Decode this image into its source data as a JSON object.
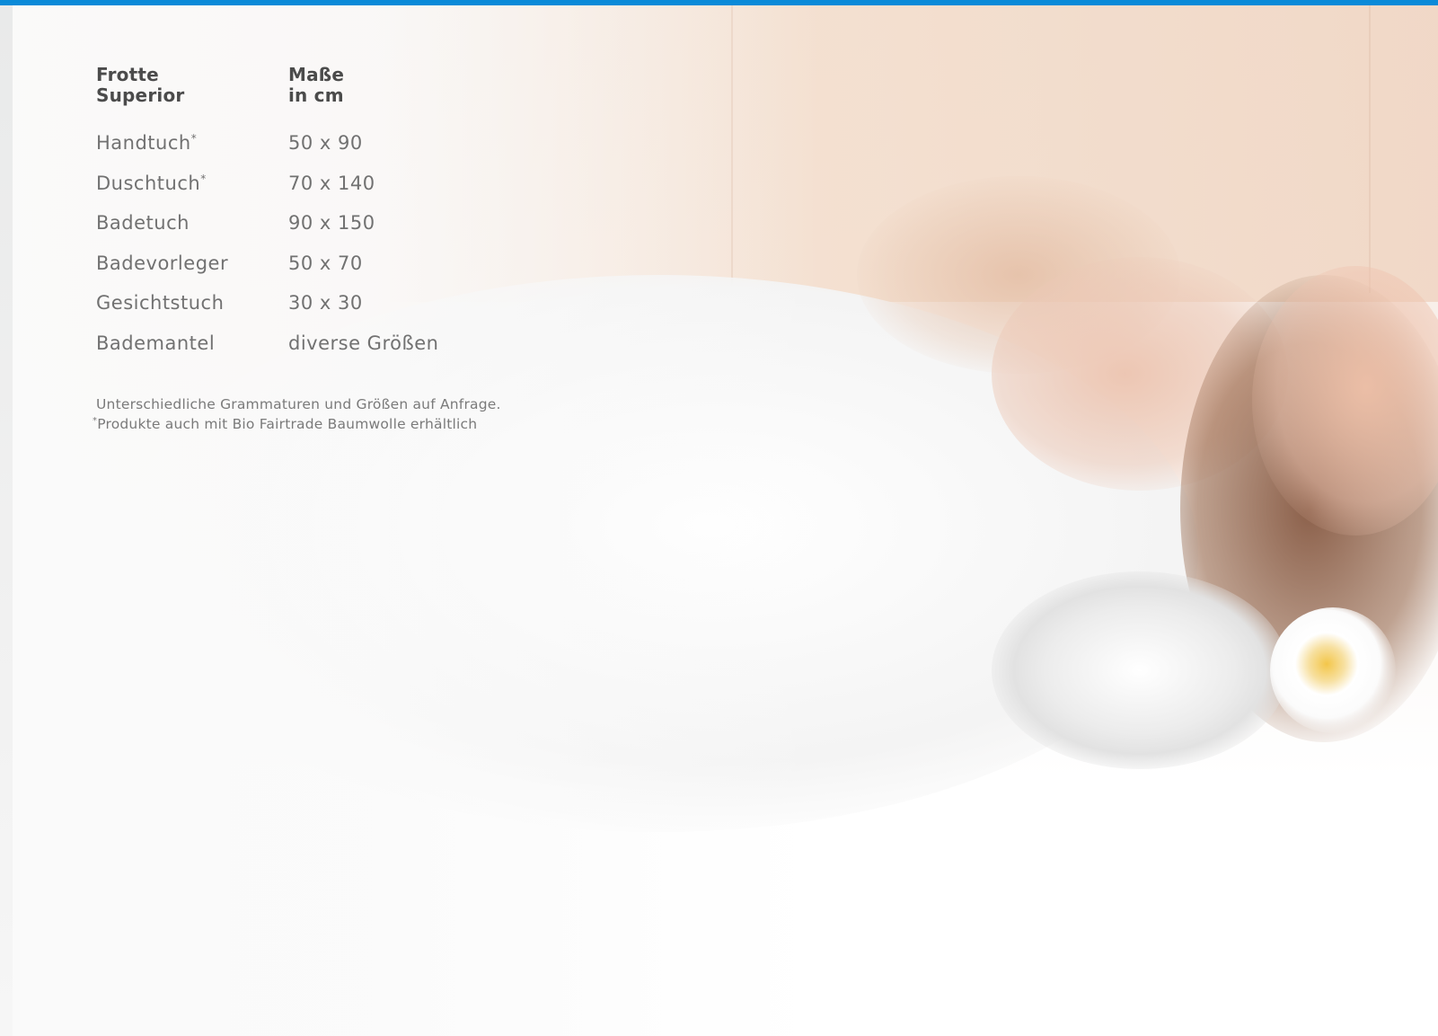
{
  "header": {
    "product_line1": "Frotte",
    "product_line2": "Superior",
    "size_line1": "Maße",
    "size_line2": "in cm"
  },
  "products": [
    {
      "name": "Handtuch",
      "marker": "*",
      "size": "50 x 90"
    },
    {
      "name": "Duschtuch",
      "marker": "*",
      "size": "70 x 140"
    },
    {
      "name": "Badetuch",
      "marker": "",
      "size": "90 x 150"
    },
    {
      "name": "Badevorleger",
      "marker": "",
      "size": "50 x 70"
    },
    {
      "name": "Gesichtstuch",
      "marker": "",
      "size": "30 x 30"
    },
    {
      "name": "Bademantel",
      "marker": "",
      "size": "diverse Größen"
    }
  ],
  "notes": {
    "line1": "Unterschiedliche Grammaturen und Größen auf Anfrage.",
    "line2_marker": "*",
    "line2": "Produkte auch mit Bio Fairtrade Baumwolle erhältlich"
  },
  "colors": {
    "accent_bar": "#0a8ad8",
    "heading_text": "#4b4b4b",
    "body_text": "#717171"
  }
}
